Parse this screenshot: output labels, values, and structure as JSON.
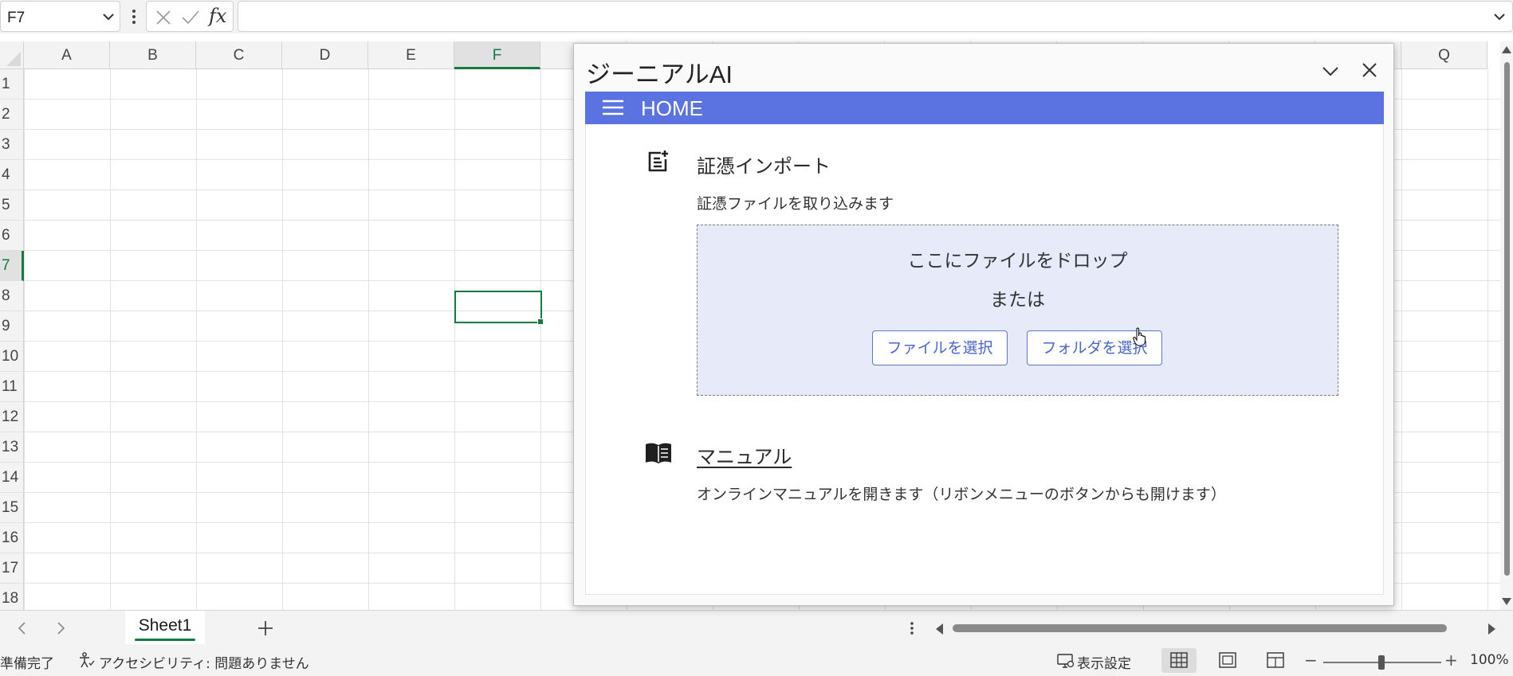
{
  "formula_bar": {
    "name_box_value": "F7",
    "fx_label": "fx",
    "formula_value": ""
  },
  "grid": {
    "columns": [
      "A",
      "B",
      "C",
      "D",
      "E",
      "F",
      "",
      "",
      "",
      "",
      "",
      "",
      "",
      "",
      "",
      "",
      "Q"
    ],
    "rows": [
      "1",
      "2",
      "3",
      "4",
      "5",
      "6",
      "7",
      "8",
      "9",
      "10",
      "11",
      "12",
      "13",
      "14",
      "15",
      "16",
      "17",
      "18"
    ],
    "selected_column": "F",
    "selected_row": "7",
    "active_cell": "F7"
  },
  "sheet_tabs": {
    "tabs": [
      "Sheet1"
    ],
    "active": "Sheet1"
  },
  "status_bar": {
    "ready_text": "準備完了",
    "accessibility_text": "アクセシビリティ: 問題ありません",
    "display_settings_text": "表示設定",
    "zoom_minus": "−",
    "zoom_plus": "+",
    "zoom_level": "100%"
  },
  "taskpane": {
    "title": "ジーニアルAI",
    "header_title": "HOME",
    "import": {
      "icon": "post-add-icon",
      "title": "証憑インポート",
      "description": "証憑ファイルを取り込みます",
      "drop_text": "ここにファイルをドロップ",
      "or_text": "または",
      "select_file_label": "ファイルを選択",
      "select_folder_label": "フォルダを選択"
    },
    "manual": {
      "icon": "menu-book-icon",
      "title": "マニュアル",
      "description": "オンラインマニュアルを開きます（リボンメニューのボタンからも開けます）"
    }
  },
  "colors": {
    "excel_green": "#107c41",
    "pane_header_blue": "#5b73e0",
    "dropzone_bg": "#e6eaf9",
    "button_text_blue": "#4a66c8"
  }
}
